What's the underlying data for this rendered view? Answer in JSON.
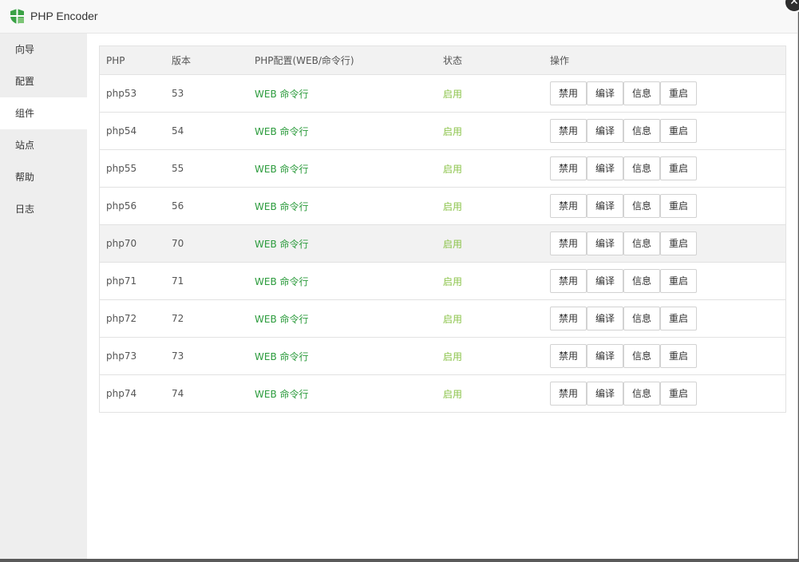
{
  "app": {
    "title": "PHP Encoder",
    "close_glyph": "✕",
    "logo_icon": "shield-icon",
    "accent": "#2b9b3c"
  },
  "sidebar": {
    "items": [
      {
        "label": "向导"
      },
      {
        "label": "配置"
      },
      {
        "label": "组件",
        "active": true
      },
      {
        "label": "站点"
      },
      {
        "label": "帮助"
      },
      {
        "label": "日志"
      }
    ]
  },
  "table": {
    "headers": {
      "php": "PHP",
      "version": "版本",
      "config": "PHP配置(WEB/命令行)",
      "status": "状态",
      "actions": "操作"
    },
    "action_labels": {
      "disable": "禁用",
      "compile": "编译",
      "info": "信息",
      "restart": "重启"
    },
    "rows": [
      {
        "php": "php53",
        "version": "53",
        "config": "WEB 命令行",
        "status": "启用"
      },
      {
        "php": "php54",
        "version": "54",
        "config": "WEB 命令行",
        "status": "启用"
      },
      {
        "php": "php55",
        "version": "55",
        "config": "WEB 命令行",
        "status": "启用"
      },
      {
        "php": "php56",
        "version": "56",
        "config": "WEB 命令行",
        "status": "启用"
      },
      {
        "php": "php70",
        "version": "70",
        "config": "WEB 命令行",
        "status": "启用",
        "highlighted": true
      },
      {
        "php": "php71",
        "version": "71",
        "config": "WEB 命令行",
        "status": "启用"
      },
      {
        "php": "php72",
        "version": "72",
        "config": "WEB 命令行",
        "status": "启用"
      },
      {
        "php": "php73",
        "version": "73",
        "config": "WEB 命令行",
        "status": "启用"
      },
      {
        "php": "php74",
        "version": "74",
        "config": "WEB 命令行",
        "status": "启用"
      }
    ]
  }
}
